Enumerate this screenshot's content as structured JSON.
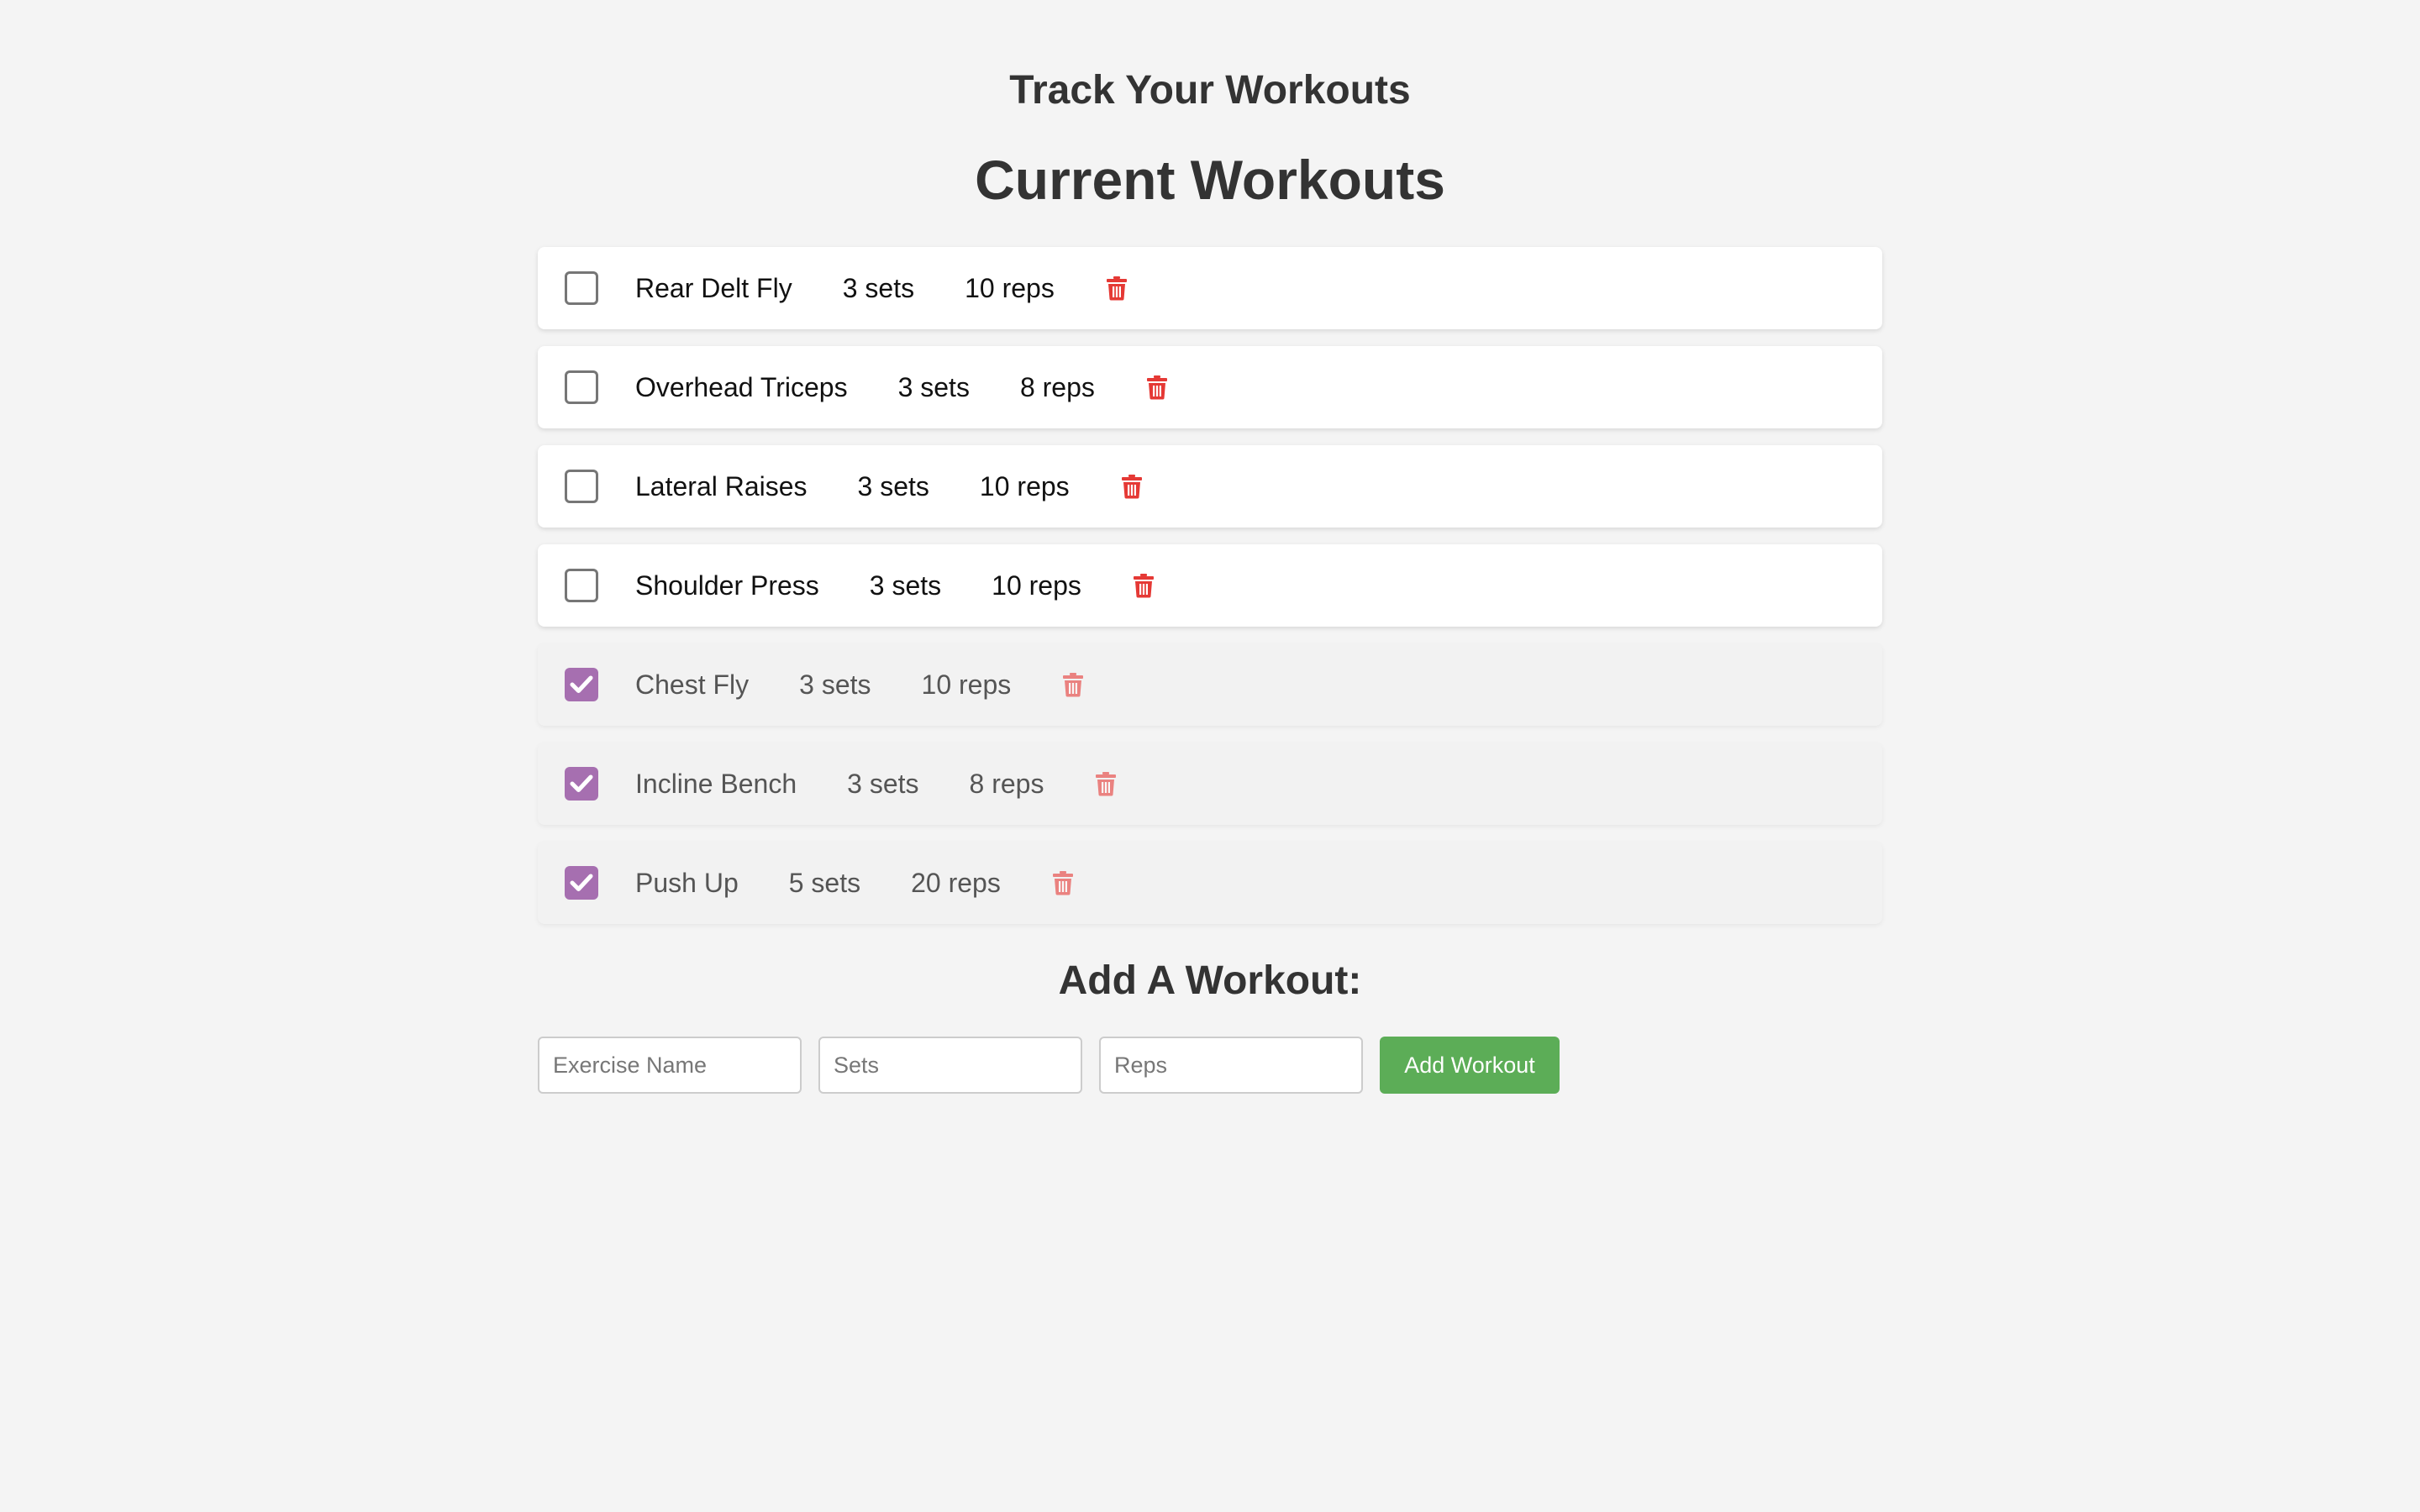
{
  "header": {
    "title": "Track Your Workouts",
    "section_title": "Current Workouts"
  },
  "workouts": [
    {
      "name": "Rear Delt Fly",
      "sets": "3 sets",
      "reps": "10 reps",
      "completed": false
    },
    {
      "name": "Overhead Triceps",
      "sets": "3 sets",
      "reps": "8 reps",
      "completed": false
    },
    {
      "name": "Lateral Raises",
      "sets": "3 sets",
      "reps": "10 reps",
      "completed": false
    },
    {
      "name": "Shoulder Press",
      "sets": "3 sets",
      "reps": "10 reps",
      "completed": false
    },
    {
      "name": "Chest Fly",
      "sets": "3 sets",
      "reps": "10 reps",
      "completed": true
    },
    {
      "name": "Incline Bench",
      "sets": "3 sets",
      "reps": "8 reps",
      "completed": true
    },
    {
      "name": "Push Up",
      "sets": "5 sets",
      "reps": "20 reps",
      "completed": true
    }
  ],
  "add_form": {
    "title": "Add A Workout:",
    "exercise_placeholder": "Exercise Name",
    "sets_placeholder": "Sets",
    "reps_placeholder": "Reps",
    "button_label": "Add Workout"
  },
  "icons": {
    "delete": "trash-icon",
    "check": "checkmark-icon"
  },
  "colors": {
    "background": "#f4f4f4",
    "checked_accent": "#a66fb0",
    "delete_red": "#e53935",
    "add_button": "#5cad57",
    "completed_row": "#f2f2f2"
  }
}
